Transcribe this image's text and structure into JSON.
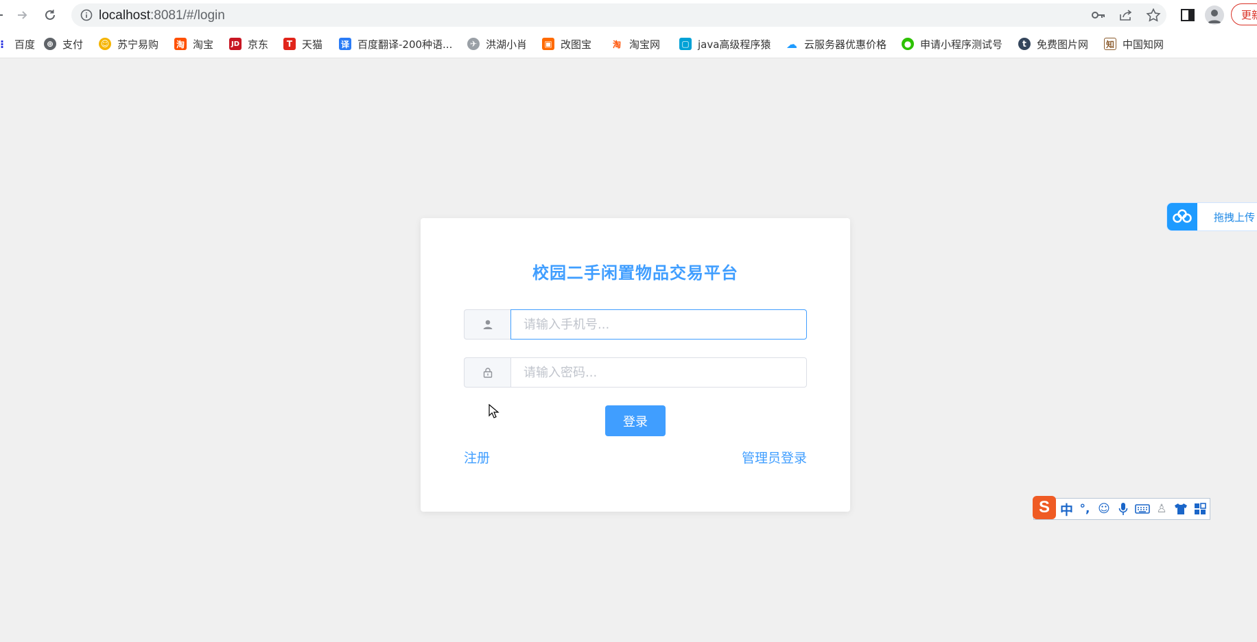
{
  "browser": {
    "url_host": "localhost",
    "url_path": ":8081/#/login",
    "update_label": "更新"
  },
  "bookmarks": [
    {
      "label": "百度",
      "icon": "paw-icon",
      "color": "#2932e1"
    },
    {
      "label": "支付",
      "icon": "globe-icon",
      "color": "#5f6368"
    },
    {
      "label": "苏宁易购",
      "icon": "lion-icon",
      "color": "#f5b400"
    },
    {
      "label": "淘宝",
      "icon": "taobao-icon",
      "color": "#ff5000"
    },
    {
      "label": "京东",
      "icon": "jd-icon",
      "color": "#c81623"
    },
    {
      "label": "天猫",
      "icon": "tmall-icon",
      "color": "#e1251b"
    },
    {
      "label": "百度翻译-200种语...",
      "icon": "translate-icon",
      "color": "#2b7cf6"
    },
    {
      "label": "洪湖小肖",
      "icon": "bird-icon",
      "color": "#9aa0a6"
    },
    {
      "label": "改图宝",
      "icon": "image-edit-icon",
      "color": "#ff6a00"
    },
    {
      "label": "淘宝网",
      "icon": "taobao-icon",
      "color": "#ff5000"
    },
    {
      "label": "java高级程序猿",
      "icon": "bilibili-icon",
      "color": "#00a1d6"
    },
    {
      "label": "云服务器优惠价格",
      "icon": "cloud-icon",
      "color": "#1e9bff"
    },
    {
      "label": "申请小程序测试号",
      "icon": "wechat-icon",
      "color": "#2dc100"
    },
    {
      "label": "免费图片网",
      "icon": "tumblr-icon",
      "color": "#35465c"
    },
    {
      "label": "中国知网",
      "icon": "cnki-icon",
      "color": "#8a5a2b"
    }
  ],
  "login": {
    "title": "校园二手闲置物品交易平台",
    "phone_placeholder": "请输入手机号...",
    "password_placeholder": "请输入密码...",
    "login_label": "登录",
    "register_label": "注册",
    "admin_label": "管理员登录"
  },
  "overlays": {
    "upload_label": "拖拽上传",
    "ime_mode": "中",
    "ime_punct": "°,"
  },
  "colors": {
    "primary": "#409eff",
    "background": "#f0f0f0"
  }
}
